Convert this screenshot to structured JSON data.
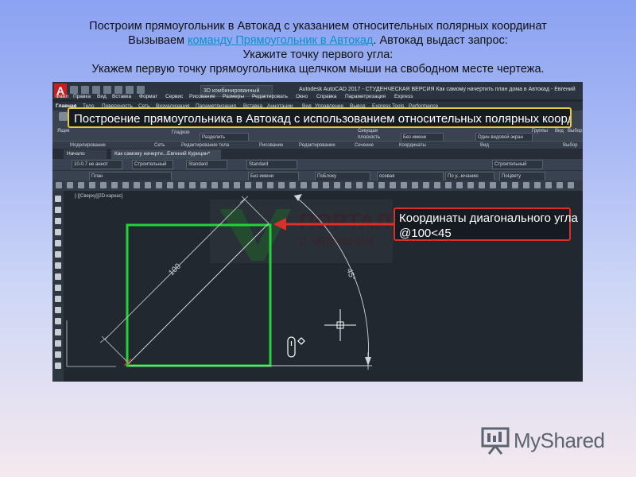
{
  "intro": {
    "line1": "Построим прямоугольник в Автокад с указанием относительных полярных координат",
    "line2_prefix": "Вызываем ",
    "line2_link": "команду Прямоугольник в Автокад",
    "line2_suffix": ". Автокад выдаст запрос:",
    "line3": "Укажите точку первого угла:",
    "line4": "Укажем первую точку прямоугольника щелчком мыши на свободном месте чертежа."
  },
  "autocad": {
    "logo": "A",
    "workspace": "3D комбинированный",
    "window_title": "Autodesk AutoCAD 2017 - СТУДЕНЧЕСКАЯ ВЕРСИЯ   Как самому начертить план дома в Автокад - Евгений Курицин.dwg",
    "menu": [
      "Файл",
      "Правка",
      "Вид",
      "Вставка",
      "Формат",
      "Сервис",
      "Рисование",
      "Размеры",
      "Редактировать",
      "Окно",
      "Справка",
      "Параметризация",
      "Express"
    ],
    "ribbon_tabs": [
      "Главная",
      "Тело",
      "Поверхность",
      "Сеть",
      "Визуализация",
      "Параметризация",
      "Вставка",
      "Аннотации",
      "Вид",
      "Управление",
      "Вывод",
      "Express Tools",
      "Performance"
    ],
    "ribbon": {
      "small_labels": [
        "Ящик",
        "Гладкое",
        "Разделить",
        "Секущая плоскость",
        "Без имени",
        "Один видовой экран",
        "Группы",
        "Вид",
        "Выбор"
      ],
      "panels": [
        "Моделирование",
        "Сеть",
        "Редактирование тела",
        "Рисование",
        "Редактирование",
        "Сечение",
        "Координаты",
        "Вид",
        "Выбор"
      ]
    },
    "top_callout": "Построение прямоугольника в Автокад с использованием относительных полярных координат",
    "doc_tabs": [
      "Начало",
      "Как самому начерти...Евгений Курицин*"
    ],
    "props_row1": {
      "annoscale": "10-0.7 не аннот",
      "style1": "Строительный",
      "style2": "Standard",
      "style3": "Standard",
      "style4": "Строительный"
    },
    "props_row2": {
      "layer": "План",
      "noname": "Без имени",
      "color": "ПоБлоку",
      "linetype": "осевая",
      "lineweight": "По у...ючанию",
      "plotstyle": "ПоЦвету"
    },
    "viewport_controls": "[-][Сверху][2D-каркас]",
    "dimension_length": "100",
    "dimension_angle": "45°",
    "right_callout_line1": "Координаты диагонального угла",
    "right_callout_line2": "@100<45",
    "watermark_line1": "ПОРТАЛ",
    "watermark_line2": "о черчении"
  },
  "brand": "MyShared",
  "colors": {
    "rectangle": "#22d33a",
    "top_callout_border": "#e9c83a",
    "right_callout_border": "#d9302b",
    "cad_background": "#212830",
    "link": "#0a8fc9"
  }
}
